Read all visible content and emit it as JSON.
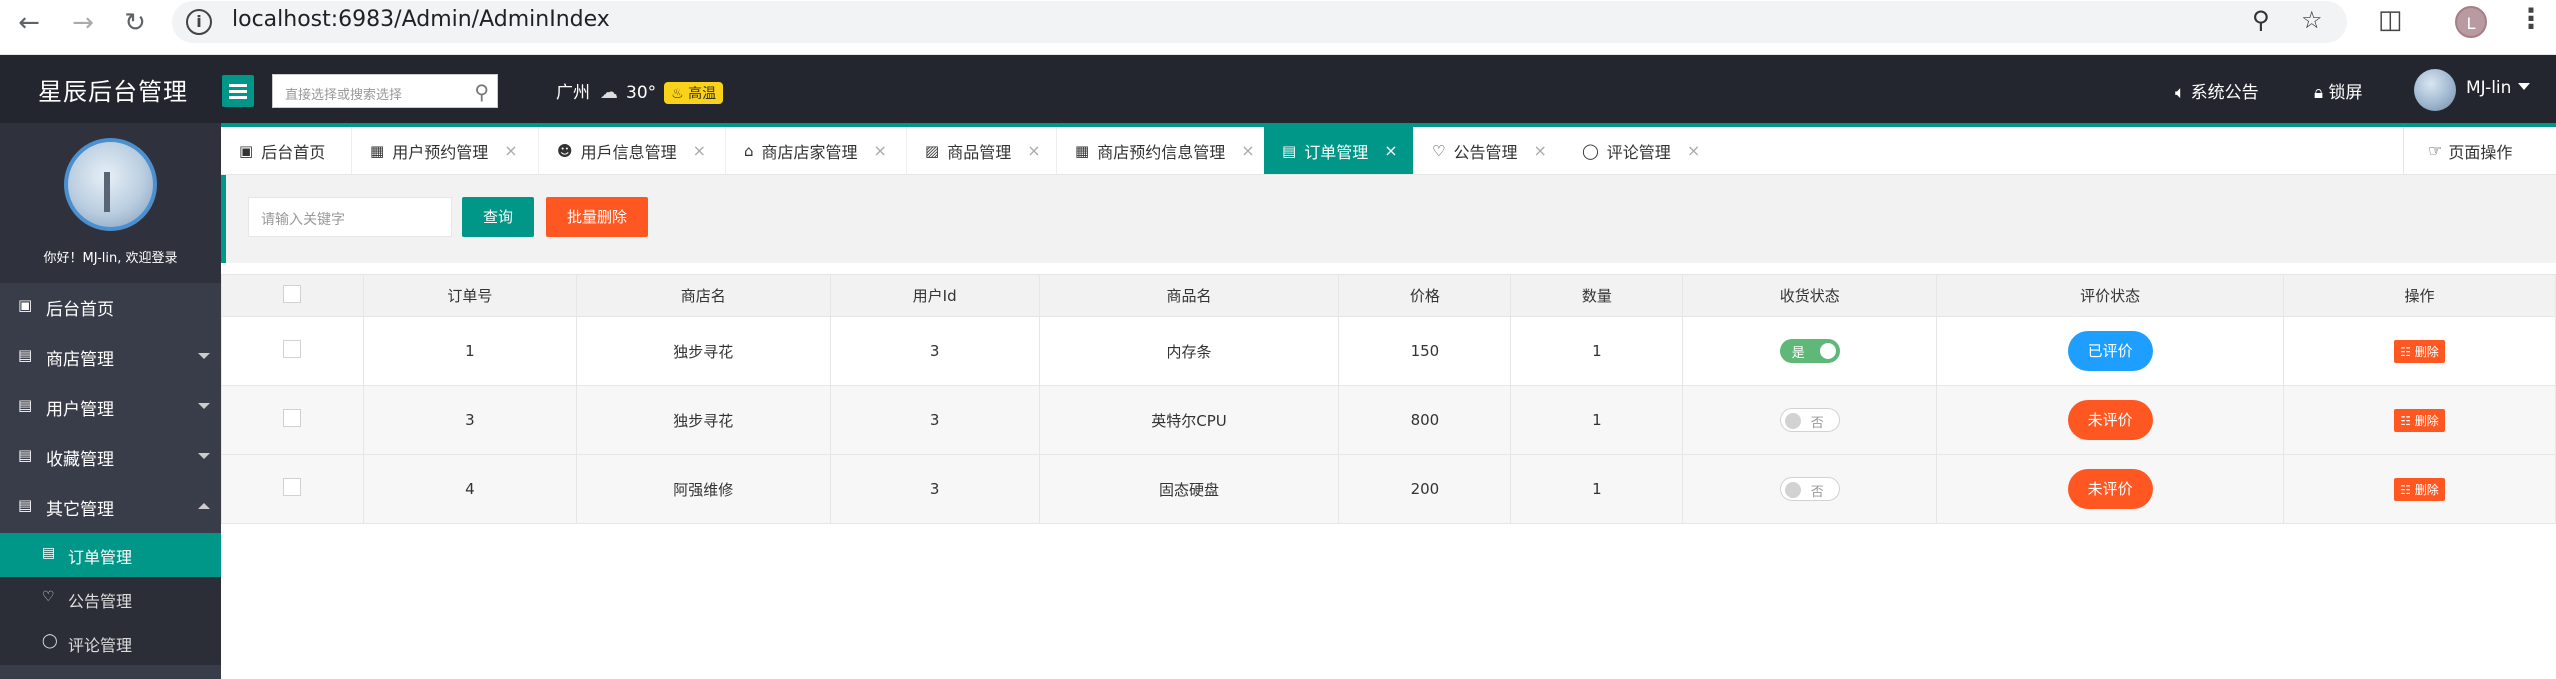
{
  "browser": {
    "url": "localhost:6983/Admin/AdminIndex",
    "back_icon": "arrow-left-icon",
    "forward_icon": "arrow-right-icon",
    "reload_icon": "reload-icon",
    "profile_initial": "L"
  },
  "header": {
    "logo": "星辰后台管理",
    "search_placeholder": "直接选择或搜索选择",
    "city": "广州",
    "temperature": "30°",
    "weather_badge": "高温",
    "announcement": "系统公告",
    "lock": "锁屏",
    "username": "MJ-lin"
  },
  "sidebar": {
    "welcome": "你好！MJ-lin, 欢迎登录",
    "items": [
      {
        "label": "后台首页",
        "icon": "monitor-icon"
      },
      {
        "label": "商店管理",
        "icon": "list-icon"
      },
      {
        "label": "用户管理",
        "icon": "list-icon"
      },
      {
        "label": "收藏管理",
        "icon": "list-icon"
      },
      {
        "label": "其它管理",
        "icon": "list-icon"
      }
    ],
    "sub_items": [
      {
        "label": "订单管理",
        "icon": "list-icon"
      },
      {
        "label": "公告管理",
        "icon": "bell-icon"
      },
      {
        "label": "评论管理",
        "icon": "chat-icon"
      }
    ]
  },
  "tabs": [
    {
      "label": "后台首页",
      "icon": "monitor-icon"
    },
    {
      "label": "用户预约管理",
      "icon": "table-icon"
    },
    {
      "label": "用戶信息管理",
      "icon": "users-icon"
    },
    {
      "label": "商店店家管理",
      "icon": "home-icon"
    },
    {
      "label": "商品管理",
      "icon": "shop-icon"
    },
    {
      "label": "商店预约信息管理",
      "icon": "table-icon"
    },
    {
      "label": "订单管理",
      "icon": "list-icon"
    },
    {
      "label": "公告管理",
      "icon": "bell-icon"
    },
    {
      "label": "评论管理",
      "icon": "chat-icon"
    }
  ],
  "page_operation": "页面操作",
  "toolbar": {
    "keyword_placeholder": "请输入关键字",
    "search_button": "查询",
    "batch_delete_button": "批量删除"
  },
  "table": {
    "columns": [
      "订单号",
      "商店名",
      "用户Id",
      "商品名",
      "价格",
      "数量",
      "收货状态",
      "评价状态",
      "操作"
    ],
    "rows": [
      {
        "order_no": "1",
        "shop": "独步寻花",
        "user_id": "3",
        "product": "内存条",
        "price": "150",
        "qty": "1",
        "received": "是",
        "review": "已评价",
        "action": "删除"
      },
      {
        "order_no": "3",
        "shop": "独步寻花",
        "user_id": "3",
        "product": "英特尔CPU",
        "price": "800",
        "qty": "1",
        "received": "否",
        "review": "未评价",
        "action": "删除"
      },
      {
        "order_no": "4",
        "shop": "阿强维修",
        "user_id": "3",
        "product": "固态硬盘",
        "price": "200",
        "qty": "1",
        "received": "否",
        "review": "未评价",
        "action": "删除"
      }
    ]
  },
  "colors": {
    "accent": "#009688",
    "danger": "#ff5722",
    "info": "#1e9fff",
    "header_bg": "#23262e",
    "sidebar_bg": "#393d49"
  }
}
